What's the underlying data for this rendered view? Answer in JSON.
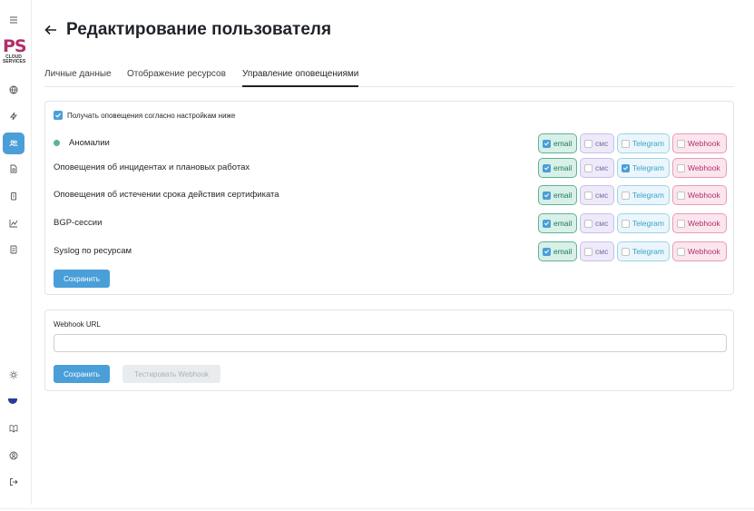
{
  "sidebar": {
    "logo_letters": "PS",
    "logo_sub1": "CLOUD",
    "logo_sub2": "SERVICES",
    "icons": [
      "menu-icon",
      "globe-icon",
      "lightning-icon",
      "users-icon",
      "document-search-icon",
      "clipboard-icon",
      "chart-icon",
      "report-icon",
      "sun-icon",
      "flag-icon",
      "book-icon",
      "user-circle-icon",
      "logout-icon"
    ],
    "active_icon": "users-icon",
    "accent": "#4a9fd8"
  },
  "header": {
    "title": "Редактирование пользователя"
  },
  "tabs": [
    {
      "label": "Личные данные",
      "active": false
    },
    {
      "label": "Отображение ресурсов",
      "active": false
    },
    {
      "label": "Управление оповещениями",
      "active": true
    }
  ],
  "notifications": {
    "master_label": "Получать оповещения согласно настройкам ниже",
    "master_checked": true,
    "channels": {
      "email": "email",
      "sms": "смс",
      "telegram": "Telegram",
      "webhook": "Webhook"
    },
    "rows": [
      {
        "label": "Аномалии",
        "email": true,
        "sms": false,
        "telegram": false,
        "webhook": false
      },
      {
        "label": "Оповещения об инцидентах и плановых работах",
        "email": true,
        "sms": false,
        "telegram": true,
        "webhook": false
      },
      {
        "label": "Оповещения об истечении срока действия сертификата",
        "email": true,
        "sms": false,
        "telegram": false,
        "webhook": false
      },
      {
        "label": "BGP-сессии",
        "email": true,
        "sms": false,
        "telegram": false,
        "webhook": false
      },
      {
        "label": "Syslog по ресурсам",
        "email": true,
        "sms": false,
        "telegram": false,
        "webhook": false
      }
    ],
    "save_label": "Сохранить"
  },
  "webhook": {
    "label": "Webhook URL",
    "value": "",
    "placeholder": "",
    "save_label": "Сохранить",
    "test_label": "Тестировать Webhook"
  },
  "colors": {
    "email": "#5fb394",
    "sms": "#c9bfe9",
    "telegram": "#9fd3e8",
    "webhook": "#e89bb8",
    "brand": "#b0306a"
  }
}
